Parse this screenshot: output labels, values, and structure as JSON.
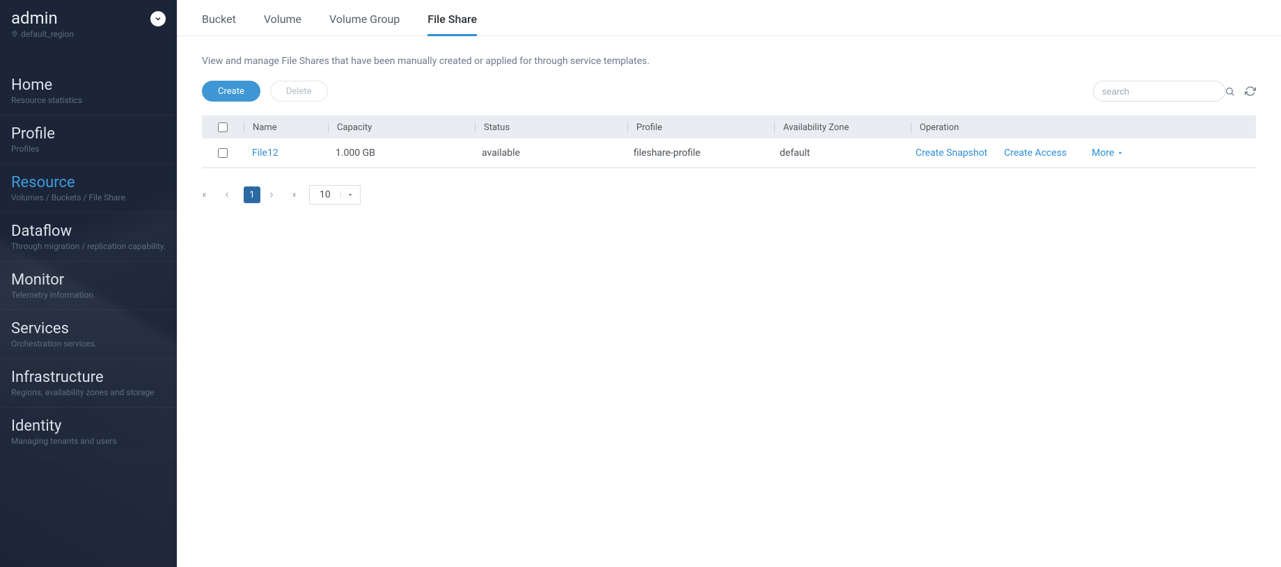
{
  "user": {
    "name": "admin",
    "region": "default_region"
  },
  "nav": [
    {
      "title": "Home",
      "sub": "Resource statistics"
    },
    {
      "title": "Profile",
      "sub": "Profiles"
    },
    {
      "title": "Resource",
      "sub": "Volumes / Buckets / File Share",
      "active": true
    },
    {
      "title": "Dataflow",
      "sub": "Through migration / replication capability."
    },
    {
      "title": "Monitor",
      "sub": "Telemetry information."
    },
    {
      "title": "Services",
      "sub": "Orchestration services."
    },
    {
      "title": "Infrastructure",
      "sub": "Regions, availability zones and storage"
    },
    {
      "title": "Identity",
      "sub": "Managing tenants and users"
    }
  ],
  "tabs": [
    {
      "label": "Bucket"
    },
    {
      "label": "Volume"
    },
    {
      "label": "Volume Group"
    },
    {
      "label": "File Share",
      "active": true
    }
  ],
  "desc": "View and manage File Shares that have been manually created or applied for through service templates.",
  "toolbar": {
    "create": "Create",
    "delete": "Delete"
  },
  "search": {
    "placeholder": "search"
  },
  "columns": {
    "name": "Name",
    "capacity": "Capacity",
    "status": "Status",
    "profile": "Profile",
    "az": "Availability Zone",
    "operation": "Operation"
  },
  "rows": [
    {
      "name": "File12",
      "capacity": "1.000 GB",
      "status": "available",
      "profile": "fileshare-profile",
      "az": "default",
      "op": {
        "snapshot": "Create Snapshot",
        "access": "Create Access",
        "more": "More"
      }
    }
  ],
  "pagination": {
    "current": "1",
    "size": "10"
  }
}
